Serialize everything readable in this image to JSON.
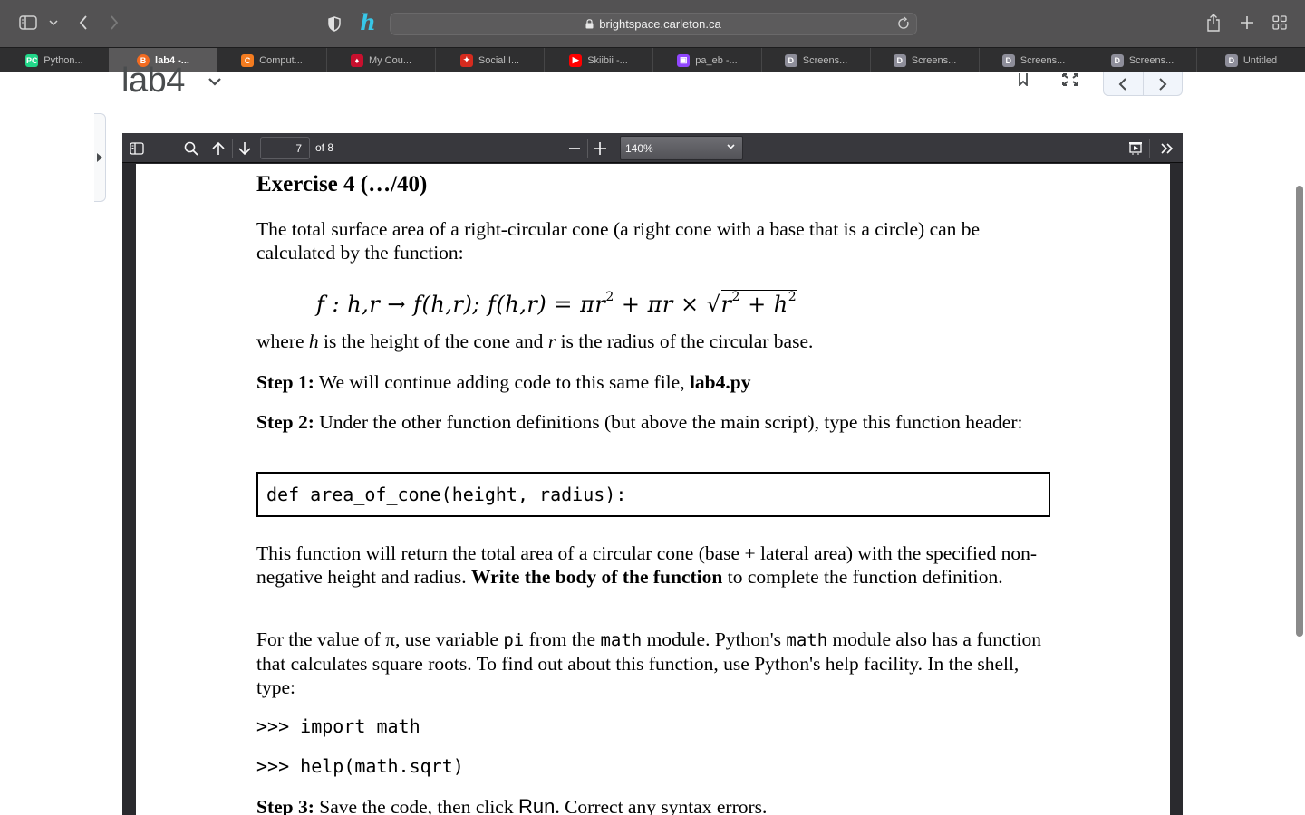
{
  "browser": {
    "url": "brightspace.carleton.ca",
    "tabs": [
      {
        "label": "Python...",
        "icon": "pycharm-icon",
        "color": "#21d789",
        "glyph": "PC"
      },
      {
        "label": "lab4 -...",
        "icon": "brightspace-icon",
        "color": "#f26b21",
        "glyph": "B",
        "active": true
      },
      {
        "label": "Comput...",
        "icon": "coursera-icon",
        "color": "#f47c20",
        "glyph": "C"
      },
      {
        "label": "My Cou...",
        "icon": "carleton-icon",
        "color": "#c8102e",
        "glyph": "♦"
      },
      {
        "label": "Social I...",
        "icon": "canada-flag-icon",
        "color": "#d52b1e",
        "glyph": "✦"
      },
      {
        "label": "Skiibii -...",
        "icon": "youtube-icon",
        "color": "#ff0000",
        "glyph": "▶"
      },
      {
        "label": "pa_eb -...",
        "icon": "twitch-icon",
        "color": "#9146ff",
        "glyph": "▣"
      },
      {
        "label": "Screens...",
        "icon": "d-app-icon",
        "color": "#8e8e9a",
        "glyph": "D"
      },
      {
        "label": "Screens...",
        "icon": "d-app-icon",
        "color": "#8e8e9a",
        "glyph": "D"
      },
      {
        "label": "Screens...",
        "icon": "d-app-icon",
        "color": "#8e8e9a",
        "glyph": "D"
      },
      {
        "label": "Screens...",
        "icon": "d-app-icon",
        "color": "#8e8e9a",
        "glyph": "D"
      },
      {
        "label": "Untitled",
        "icon": "d-app-icon",
        "color": "#8e8e9a",
        "glyph": "D"
      }
    ]
  },
  "page": {
    "title": "lab4"
  },
  "pdf_viewer": {
    "current_page": "7",
    "page_count_label": "of 8",
    "zoom_level": "140%"
  },
  "document": {
    "heading": "Exercise 4 (…/40)",
    "intro": "The total surface area of a right-circular cone (a right cone with a base that is a circle) can be calculated by the function:",
    "formula": {
      "lhs": "f : h,r → f(h,r); f(h,r) = πr",
      "sq1": "2",
      "mid": " + πr × √",
      "radicand": "r",
      "sq2": "2",
      "plus": " + h",
      "sq3": "2"
    },
    "where": {
      "a": "where ",
      "h": "h",
      "b": " is the height of the cone and ",
      "r": "r",
      "c": " is the radius of the circular base."
    },
    "step1": {
      "label": "Step 1:",
      "text": " We will continue adding code to this same file, ",
      "file": "lab4.py"
    },
    "step2": {
      "label": "Step 2:",
      "text": " Under the other function definitions (but above the main script), type this function header:"
    },
    "code_header": "def area_of_cone(height, radius):",
    "body_para": {
      "a": "This function will return the total area of a circular cone (base + lateral area) with the specified non-negative height and radius. ",
      "bold": "Write the body of the function",
      "b": " to complete the function definition."
    },
    "pi_para": {
      "a": "For the value of π, use variable ",
      "pi": "pi",
      "b": " from the ",
      "math1": "math",
      "c": " module. Python's ",
      "math2": "math",
      "d": " module also has a function that calculates square roots. To find out about this function, use Python's help facility. In the shell, type:"
    },
    "shell_lines": [
      ">>> import math",
      ">>> help(math.sqrt)"
    ],
    "step3": {
      "label": "Step 3:",
      "text_a": " Save the code, then click ",
      "run": "Run",
      "text_b": ". Correct any syntax errors."
    }
  }
}
